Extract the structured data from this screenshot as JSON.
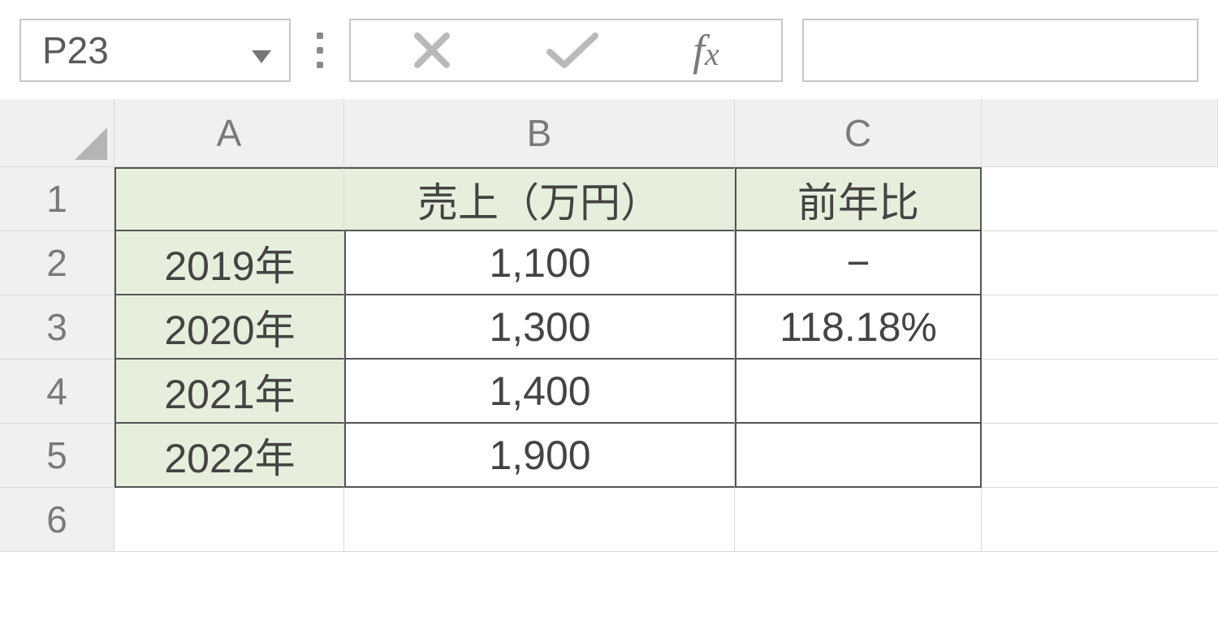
{
  "name_box": "P23",
  "formula_bar": "",
  "icons": {
    "cancel": "cancel-icon",
    "enter": "enter-icon",
    "fx": "fx-icon"
  },
  "columns": [
    "A",
    "B",
    "C"
  ],
  "row_numbers": [
    "1",
    "2",
    "3",
    "4",
    "5",
    "6"
  ],
  "table": {
    "headers": {
      "A": "",
      "B": "売上（万円）",
      "C": "前年比"
    },
    "rows": [
      {
        "A": "2019年",
        "B": "1,100",
        "C": "−"
      },
      {
        "A": "2020年",
        "B": "1,300",
        "C": "118.18%"
      },
      {
        "A": "2021年",
        "B": "1,400",
        "C": ""
      },
      {
        "A": "2022年",
        "B": "1,900",
        "C": ""
      }
    ]
  }
}
